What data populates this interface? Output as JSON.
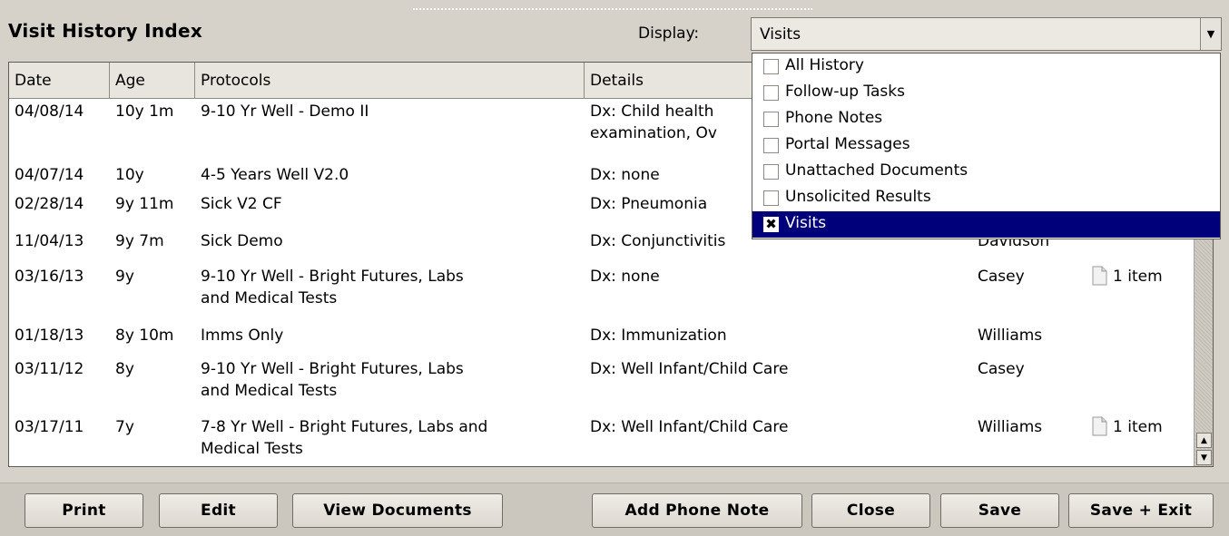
{
  "header": {
    "title": "Visit History Index",
    "display_label": "Display:",
    "display_value": "Visits"
  },
  "table": {
    "columns": [
      "Date",
      "Age",
      "Protocols",
      "Details"
    ],
    "rows": [
      {
        "date": "04/08/14",
        "age": "10y 1m",
        "protocol": [
          "9-10 Yr Well - Demo II"
        ],
        "details": [
          "Dx: Child health",
          "examination, Ov"
        ],
        "provider": "",
        "attachments": ""
      },
      {
        "date": "04/07/14",
        "age": "10y",
        "protocol": [
          "4-5 Years Well V2.0"
        ],
        "details": [
          "Dx: none"
        ],
        "provider": "",
        "attachments": ""
      },
      {
        "date": "02/28/14",
        "age": "9y 11m",
        "protocol": [
          "Sick V2 CF"
        ],
        "details": [
          "Dx: Pneumonia"
        ],
        "provider": "",
        "attachments": ""
      },
      {
        "date": "11/04/13",
        "age": "9y 7m",
        "protocol": [
          "Sick Demo"
        ],
        "details": [
          "Dx: Conjunctivitis"
        ],
        "provider": "Davidson",
        "attachments": ""
      },
      {
        "date": "03/16/13",
        "age": "9y",
        "protocol": [
          "9-10 Yr Well - Bright Futures, Labs",
          "and Medical Tests"
        ],
        "details": [
          "Dx: none"
        ],
        "provider": "Casey",
        "attachments": "1 item"
      },
      {
        "date": "01/18/13",
        "age": "8y 10m",
        "protocol": [
          "Imms Only"
        ],
        "details": [
          "Dx: Immunization"
        ],
        "provider": "Williams",
        "attachments": ""
      },
      {
        "date": "03/11/12",
        "age": "8y",
        "protocol": [
          "9-10 Yr Well - Bright Futures, Labs",
          "and Medical Tests"
        ],
        "details": [
          "Dx: Well Infant/Child Care"
        ],
        "provider": "Casey",
        "attachments": ""
      },
      {
        "date": "03/17/11",
        "age": "7y",
        "protocol": [
          "7-8 Yr Well - Bright Futures, Labs and",
          "Medical Tests"
        ],
        "details": [
          "Dx: Well Infant/Child Care"
        ],
        "provider": "Williams",
        "attachments": "1 item"
      }
    ]
  },
  "dropdown": {
    "options": [
      {
        "label": "All History",
        "checked": false
      },
      {
        "label": "Follow-up Tasks",
        "checked": false
      },
      {
        "label": "Phone Notes",
        "checked": false
      },
      {
        "label": "Portal Messages",
        "checked": false
      },
      {
        "label": "Unattached Documents",
        "checked": false
      },
      {
        "label": "Unsolicited Results",
        "checked": false
      },
      {
        "label": "Visits",
        "checked": true,
        "selected": true
      }
    ],
    "check_mark": "✖"
  },
  "buttons": {
    "print": "Print",
    "edit": "Edit",
    "view_documents": "View Documents",
    "add_phone_note": "Add Phone Note",
    "close": "Close",
    "save": "Save",
    "save_exit": "Save + Exit"
  },
  "icons": {
    "combo_arrow": "chevron-down-icon",
    "scroll_up": "arrow-up-icon",
    "scroll_down": "arrow-down-icon",
    "attachment": "document-icon"
  },
  "colors": {
    "selection": "#00007a",
    "background": "#d6d2c9"
  }
}
